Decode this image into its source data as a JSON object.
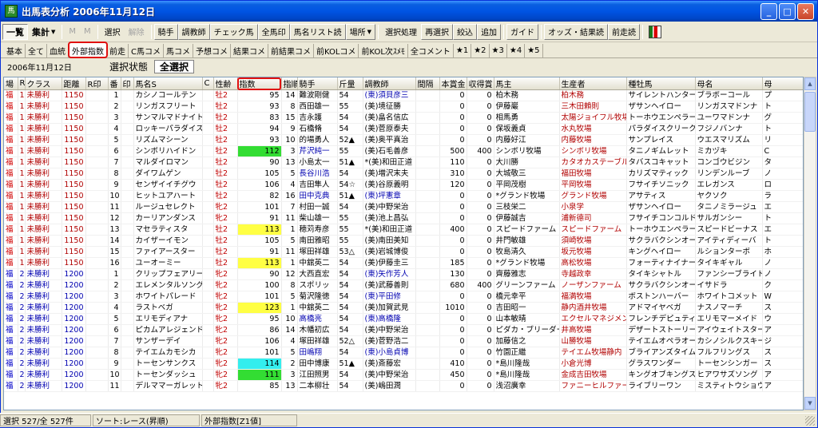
{
  "window": {
    "title": "出馬表分析 2006年11月12日"
  },
  "toolbar": {
    "items": [
      {
        "label": "一覧",
        "kind": "pressed-bold"
      },
      {
        "label": "集計",
        "kind": "bold-caret"
      },
      {
        "label": "M",
        "kind": "disabled"
      },
      {
        "label": "M",
        "kind": "disabled"
      },
      {
        "label": "選択",
        "kind": "normal"
      },
      {
        "label": "解除",
        "kind": "disabled"
      },
      {
        "label": "騎手",
        "kind": "raised"
      },
      {
        "label": "調教師",
        "kind": "raised"
      },
      {
        "label": "チェック馬",
        "kind": "raised"
      },
      {
        "label": "全馬印",
        "kind": "raised"
      },
      {
        "label": "馬名リスト読",
        "kind": "raised"
      },
      {
        "label": "場所",
        "kind": "raised-caret"
      },
      {
        "label": "選択処理",
        "kind": "normal"
      },
      {
        "label": "再選択",
        "kind": "raised"
      },
      {
        "label": "絞込",
        "kind": "raised"
      },
      {
        "label": "追加",
        "kind": "raised"
      },
      {
        "label": "ガイド",
        "kind": "raised"
      },
      {
        "label": "オッズ・結果読",
        "kind": "raised"
      },
      {
        "label": "前走読",
        "kind": "raised"
      }
    ]
  },
  "tabs": [
    "基本",
    "全て",
    "血統",
    "外部指数",
    "前走",
    "C馬コメ",
    "馬コメ",
    "予想コメ",
    "結果コメ",
    "前結果コメ",
    "前KOLコメ",
    "前KOL次ｽﾒﾓ",
    "全コメント",
    "★1",
    "★2",
    "★3",
    "★4",
    "★5"
  ],
  "active_tab": "外部指数",
  "info": {
    "date": "2006年11月12日",
    "select_label": "選択状態",
    "select_all": "全選択"
  },
  "grid": {
    "headers": [
      "場",
      "R",
      "クラス",
      "距離",
      "R印",
      "番",
      "印",
      "馬名S",
      "C",
      "性齢",
      "指数",
      "指順",
      "騎手",
      "斤量",
      "調教師",
      "間隔",
      "本賞金",
      "収得賞",
      "馬主",
      "生産者",
      "種牡馬",
      "母名",
      "母"
    ],
    "rows": [
      [
        "福",
        "1",
        "未勝利",
        "1150",
        "",
        "1",
        "",
        "カシノコールテン",
        "",
        "牡2",
        "95",
        "14",
        "難波剛健",
        "54",
        "(東)須貝彦三",
        "",
        "0",
        "0",
        "柏木務",
        "柏木務",
        "サイレントハンター",
        "ブラボーコール",
        "プ"
      ],
      [
        "福",
        "1",
        "未勝利",
        "1150",
        "",
        "2",
        "",
        "リンガスフリート",
        "",
        "牡2",
        "93",
        "8",
        "西田雄一",
        "55",
        "(美)境征勝",
        "",
        "0",
        "0",
        "伊藤巖",
        "三木田賴則",
        "ザサンヘイロー",
        "リンガスマドンナ",
        "ト"
      ],
      [
        "福",
        "1",
        "未勝利",
        "1150",
        "",
        "3",
        "",
        "サンマルマドナイト",
        "",
        "牡2",
        "83",
        "15",
        "吉永護",
        "54",
        "(美)畠名信広",
        "",
        "0",
        "0",
        "相馬勇",
        "太陽ジョイフル牧場",
        "トーホウエンペラー",
        "ユーワマドンナ",
        "グ"
      ],
      [
        "福",
        "1",
        "未勝利",
        "1150",
        "",
        "4",
        "",
        "ロッキーパラダイス",
        "",
        "牡2",
        "94",
        "9",
        "石橋脩",
        "54",
        "(美)菅原泰夫",
        "",
        "0",
        "0",
        "保坂義貞",
        "水丸牧場",
        "パラダイスクリーク",
        "フジノバンナ",
        "ト"
      ],
      [
        "福",
        "1",
        "未勝利",
        "1150",
        "",
        "5",
        "",
        "リズムマシーン",
        "",
        "牡2",
        "93",
        "10",
        "的場勇人",
        "52▲",
        "(美)奥平真治",
        "",
        "0",
        "0",
        "内藤好江",
        "内藤牧場",
        "サンプレイス",
        "ウエスマリズム",
        "リ"
      ],
      [
        "福",
        "1",
        "未勝利",
        "1150",
        "",
        "6",
        "",
        "シンボリハイドン",
        "",
        "牡2",
        "112",
        "3",
        "芹沢純一",
        "55",
        "(美)石毛善彦",
        "",
        "500",
        "400",
        "シンボリ牧場",
        "シンボリ牧場",
        "タニノギムレット",
        "ミカヅキ",
        "C"
      ],
      [
        "福",
        "1",
        "未勝利",
        "1150",
        "",
        "7",
        "",
        "マルダイロマン",
        "",
        "牡2",
        "90",
        "13",
        "小島太一",
        "51▲",
        "*(美)和田正道",
        "",
        "110",
        "0",
        "大川勝",
        "カタオカステーブル",
        "タバスコキャット",
        "コンゴウビジン",
        "タ"
      ],
      [
        "福",
        "1",
        "未勝利",
        "1150",
        "",
        "8",
        "",
        "ダイワムゲン",
        "",
        "牡2",
        "105",
        "5",
        "長谷川浩",
        "54",
        "(美)増沢末夫",
        "",
        "310",
        "0",
        "大城敬三",
        "福田牧場",
        "カリズマティック",
        "リンデンルーブ",
        "ノ"
      ],
      [
        "福",
        "1",
        "未勝利",
        "1150",
        "",
        "9",
        "",
        "センザイイチグウ",
        "",
        "牡2",
        "106",
        "4",
        "吉田隼人",
        "54☆",
        "(美)谷原義明",
        "",
        "120",
        "0",
        "平岡茂樹",
        "平岡牧場",
        "フサイチソニック",
        "エレガンス",
        "ロ"
      ],
      [
        "福",
        "1",
        "未勝利",
        "1150",
        "",
        "10",
        "",
        "ヒットユアハート",
        "",
        "牡2",
        "82",
        "16",
        "田中克典",
        "51▲",
        "(東)坪憲章",
        "",
        "0",
        "0",
        "*グランド牧場",
        "グランド牧場",
        "アサティス",
        "ヤクソク",
        "ラ"
      ],
      [
        "福",
        "1",
        "未勝利",
        "1150",
        "",
        "11",
        "",
        "ルージュセレクト",
        "",
        "牝2",
        "101",
        "7",
        "村田一誠",
        "54",
        "(美)中野栄治",
        "",
        "0",
        "0",
        "三枝栄二",
        "小泉学",
        "ザサンヘイロー",
        "タニノミラージュ",
        "エ"
      ],
      [
        "福",
        "1",
        "未勝利",
        "1150",
        "",
        "12",
        "",
        "カーリアンダンス",
        "",
        "牝2",
        "91",
        "11",
        "柴山雄一",
        "55",
        "(美)池上昌弘",
        "",
        "0",
        "0",
        "伊藤誠吉",
        "浦新德司",
        "フサイチコンコルド",
        "サルガンシー",
        "ト"
      ],
      [
        "福",
        "1",
        "未勝利",
        "1150",
        "",
        "13",
        "",
        "マセラティスタ",
        "",
        "牡2",
        "113",
        "1",
        "穂苅寿彦",
        "55",
        "*(美)和田正道",
        "",
        "400",
        "0",
        "スピードファーム",
        "スピードファーム",
        "トーホウエンペラー",
        "スピードビーナス",
        "エ"
      ],
      [
        "福",
        "1",
        "未勝利",
        "1150",
        "",
        "14",
        "",
        "カイザーイモン",
        "",
        "牡2",
        "105",
        "5",
        "南田雅昭",
        "55",
        "(美)南田美知",
        "",
        "0",
        "0",
        "井門敏雄",
        "須崎牧場",
        "サクラバクシンオー",
        "アイティディーバ",
        "ト"
      ],
      [
        "福",
        "1",
        "未勝利",
        "1150",
        "",
        "15",
        "",
        "ファイアースター",
        "",
        "牡2",
        "91",
        "11",
        "塚田祥雄",
        "53△",
        "(美)岩城博俊",
        "",
        "0",
        "0",
        "牧島清久",
        "坂元牧場",
        "キングヘイロー",
        "ルションターボ",
        "ホ"
      ],
      [
        "福",
        "1",
        "未勝利",
        "1150",
        "",
        "16",
        "",
        "ユーオーミー",
        "",
        "牡2",
        "113",
        "1",
        "中舘英二",
        "54",
        "(美)伊藤圭三",
        "",
        "185",
        "0",
        "*グランド牧場",
        "高松牧場",
        "フォーティナイナー",
        "タイキギャル",
        "ノ"
      ],
      [
        "福",
        "2",
        "未勝利",
        "1200",
        "",
        "1",
        "",
        "クリップフェアリー",
        "",
        "牝2",
        "90",
        "12",
        "大西直宏",
        "54",
        "(東)矢作芳人",
        "",
        "130",
        "0",
        "齊藤雅志",
        "寺越政幸",
        "タイキシャトル",
        "ファンシーブライド",
        "ノ"
      ],
      [
        "福",
        "2",
        "未勝利",
        "1200",
        "",
        "2",
        "",
        "エレメンタルソング",
        "",
        "牝2",
        "100",
        "8",
        "スポリッ",
        "54",
        "(美)武藤善則",
        "",
        "680",
        "400",
        "グリーンファーム",
        "ノーザンファーム",
        "サクラバクシンオー",
        "イサドラ",
        "ク"
      ],
      [
        "福",
        "2",
        "未勝利",
        "1200",
        "",
        "3",
        "",
        "ホワイトパレード",
        "",
        "牝2",
        "101",
        "5",
        "菊沢隆徳",
        "54",
        "(東)平田修",
        "",
        "0",
        "0",
        "橋元幸平",
        "福満牧場",
        "ボストンハーバー",
        "ホワイトコメット",
        "W"
      ],
      [
        "福",
        "2",
        "未勝利",
        "1200",
        "",
        "4",
        "",
        "ラストベガ",
        "",
        "牝2",
        "123",
        "1",
        "中舘英二",
        "54",
        "(美)加賀武見",
        "",
        "1010",
        "0",
        "吉田昭一",
        "静内酒井牧場",
        "アドマイヤベガ",
        "ナスノマーチ",
        "ス"
      ],
      [
        "福",
        "2",
        "未勝利",
        "1200",
        "",
        "5",
        "",
        "エリモディアナ",
        "",
        "牝2",
        "95",
        "10",
        "高橋亮",
        "54",
        "(東)高橋隆",
        "",
        "0",
        "0",
        "山本敏晴",
        "エクセルマネジメン",
        "フレンチデピュティ",
        "エリモマーメイド",
        "ウ"
      ],
      [
        "福",
        "2",
        "未勝利",
        "1200",
        "",
        "6",
        "",
        "ピカムアレジェンド",
        "",
        "牝2",
        "86",
        "14",
        "木幡初広",
        "54",
        "(美)中野栄治",
        "",
        "0",
        "0",
        "ピダカ・ブリーダーズ",
        "井高牧場",
        "デザートストーリー",
        "アイウェイトスター",
        "ア"
      ],
      [
        "福",
        "2",
        "未勝利",
        "1200",
        "",
        "7",
        "",
        "サンザーデイ",
        "",
        "牝2",
        "106",
        "4",
        "塚田祥雄",
        "52△",
        "(美)菅野浩二",
        "",
        "0",
        "0",
        "加藤信之",
        "山勝牧場",
        "テイエムオペラオー",
        "カシノシルクスキー",
        "ジ"
      ],
      [
        "福",
        "2",
        "未勝利",
        "1200",
        "",
        "8",
        "",
        "テイエムカモシカ",
        "",
        "牝2",
        "101",
        "5",
        "田嶋翔",
        "54",
        "(東)小島貞博",
        "",
        "0",
        "0",
        "竹園正繼",
        "テイエム牧場静内",
        "ブライアンズタイム",
        "フルフリングス",
        "ス"
      ],
      [
        "福",
        "2",
        "未勝利",
        "1200",
        "",
        "9",
        "",
        "トーセンサンクス",
        "",
        "牝2",
        "114",
        "2",
        "田中博康",
        "51▲",
        "(美)斎藤宏",
        "",
        "410",
        "0",
        "*島川隆哉",
        "小倉光博",
        "グラスワンダー",
        "トーセンシンガー",
        "ス"
      ],
      [
        "福",
        "2",
        "未勝利",
        "1200",
        "",
        "10",
        "",
        "トーセンダッシュ",
        "",
        "牝2",
        "111",
        "3",
        "江田照男",
        "54",
        "(美)中野栄治",
        "",
        "450",
        "0",
        "*島川隆哉",
        "金成吉田牧場",
        "キングオブキングス",
        "ヒアワサズソング",
        "ア"
      ],
      [
        "福",
        "2",
        "未勝利",
        "1200",
        "",
        "11",
        "",
        "デルママーガレット",
        "",
        "牝2",
        "85",
        "13",
        "二本柳壮",
        "54",
        "(美)嶋田潤",
        "",
        "0",
        "0",
        "浅沼廣幸",
        "ファニーヒルファーム",
        "ライブリーワン",
        "ミスティトウショウ",
        "ア"
      ]
    ],
    "index_highlights": {
      "5": "green",
      "12": "yellow",
      "15": "yellow",
      "19": "yellow",
      "24": "cyan",
      "25": "green"
    }
  },
  "statusbar": {
    "count": "選択 527/全 527件",
    "sort": "ソート:レース(昇順)",
    "field": "外部指数[Z1値]"
  }
}
